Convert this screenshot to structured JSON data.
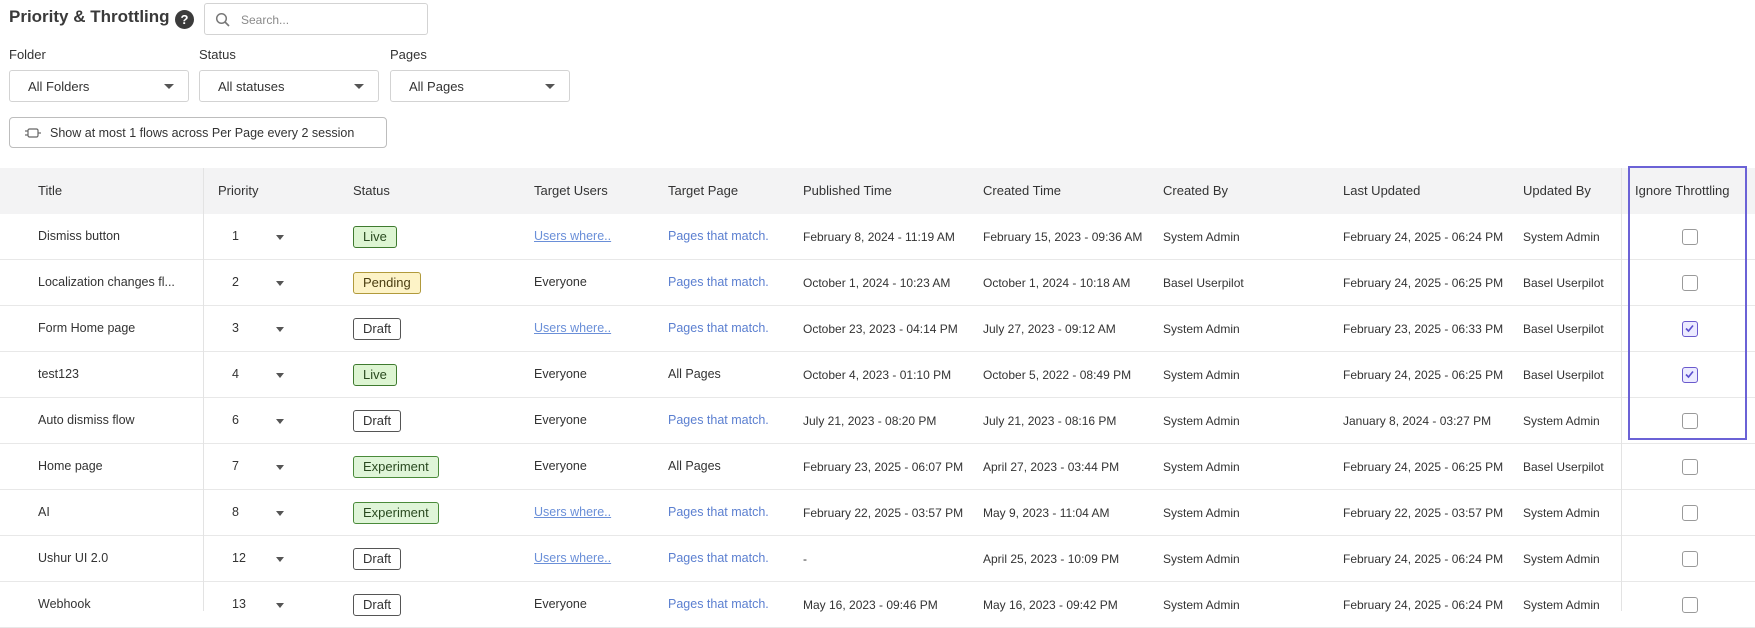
{
  "header": {
    "title": "Priority & Throttling",
    "help": "?",
    "search_placeholder": "Search..."
  },
  "filters": {
    "folder": {
      "label": "Folder",
      "value": "All Folders"
    },
    "status": {
      "label": "Status",
      "value": "All statuses"
    },
    "pages": {
      "label": "Pages",
      "value": "All Pages"
    }
  },
  "rule": {
    "text": "Show at most 1 flows across Per Page every 2 session"
  },
  "columns": {
    "title": "Title",
    "priority": "Priority",
    "status": "Status",
    "target_users": "Target Users",
    "target_page": "Target Page",
    "published": "Published Time",
    "created": "Created Time",
    "created_by": "Created By",
    "last_updated": "Last Updated",
    "updated_by": "Updated By",
    "ignore": "Ignore Throttling"
  },
  "rows": [
    {
      "title": "Dismiss button",
      "priority": "1",
      "status": "Live",
      "target_users": "Users where..",
      "target_page": "Pages that match.",
      "published": "February 8, 2024 - 11:19 AM",
      "created": "February 15, 2023 - 09:36 AM",
      "created_by": "System Admin",
      "last_updated": "February 24, 2025 - 06:24 PM",
      "updated_by": "System Admin",
      "ignore": false
    },
    {
      "title": "Localization changes fl...",
      "priority": "2",
      "status": "Pending",
      "target_users": "Everyone",
      "target_page": "Pages that match.",
      "published": "October 1, 2024 - 10:23 AM",
      "created": "October 1, 2024 - 10:18 AM",
      "created_by": "Basel Userpilot",
      "last_updated": "February 24, 2025 - 06:25 PM",
      "updated_by": "Basel Userpilot",
      "ignore": false
    },
    {
      "title": "Form Home page",
      "priority": "3",
      "status": "Draft",
      "target_users": "Users where..",
      "target_page": "Pages that match.",
      "published": "October 23, 2023 - 04:14 PM",
      "created": "July 27, 2023 - 09:12 AM",
      "created_by": "System Admin",
      "last_updated": "February 23, 2025 - 06:33 PM",
      "updated_by": "Basel Userpilot",
      "ignore": true
    },
    {
      "title": "test123",
      "priority": "4",
      "status": "Live",
      "target_users": "Everyone",
      "target_page": "All Pages",
      "published": "October 4, 2023 - 01:10 PM",
      "created": "October 5, 2022 - 08:49 PM",
      "created_by": "System Admin",
      "last_updated": "February 24, 2025 - 06:25 PM",
      "updated_by": "Basel Userpilot",
      "ignore": true
    },
    {
      "title": "Auto dismiss flow",
      "priority": "6",
      "status": "Draft",
      "target_users": "Everyone",
      "target_page": "Pages that match.",
      "published": "July 21, 2023 - 08:20 PM",
      "created": "July 21, 2023 - 08:16 PM",
      "created_by": "System Admin",
      "last_updated": "January 8, 2024 - 03:27 PM",
      "updated_by": "System Admin",
      "ignore": false
    },
    {
      "title": "Home page",
      "priority": "7",
      "status": "Experiment",
      "target_users": "Everyone",
      "target_page": "All Pages",
      "published": "February 23, 2025 - 06:07 PM",
      "created": "April 27, 2023 - 03:44 PM",
      "created_by": "System Admin",
      "last_updated": "February 24, 2025 - 06:25 PM",
      "updated_by": "Basel Userpilot",
      "ignore": false
    },
    {
      "title": "AI",
      "priority": "8",
      "status": "Experiment",
      "target_users": "Users where..",
      "target_page": "Pages that match.",
      "published": "February 22, 2025 - 03:57 PM",
      "created": "May 9, 2023 - 11:04 AM",
      "created_by": "System Admin",
      "last_updated": "February 22, 2025 - 03:57 PM",
      "updated_by": "System Admin",
      "ignore": false
    },
    {
      "title": "Ushur UI 2.0",
      "priority": "12",
      "status": "Draft",
      "target_users": "Users where..",
      "target_page": "Pages that match.",
      "published": "-",
      "created": "April 25, 2023 - 10:09 PM",
      "created_by": "System Admin",
      "last_updated": "February 24, 2025 - 06:24 PM",
      "updated_by": "System Admin",
      "ignore": false
    },
    {
      "title": "Webhook",
      "priority": "13",
      "status": "Draft",
      "target_users": "Everyone",
      "target_page": "Pages that match.",
      "published": "May 16, 2023 - 09:46 PM",
      "created": "May 16, 2023 - 09:42 PM",
      "created_by": "System Admin",
      "last_updated": "February 24, 2025 - 06:24 PM",
      "updated_by": "System Admin",
      "ignore": false
    }
  ]
}
